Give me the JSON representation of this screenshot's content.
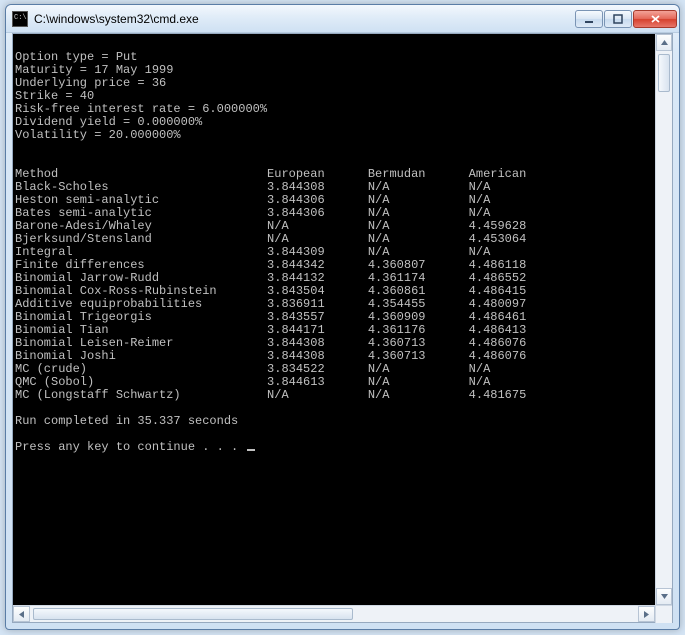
{
  "window": {
    "title": "C:\\windows\\system32\\cmd.exe"
  },
  "output": {
    "params": [
      "Option type = Put",
      "Maturity = 17 May 1999",
      "Underlying price = 36",
      "Strike = 40",
      "Risk-free interest rate = 6.000000%",
      "Dividend yield = 0.000000%",
      "Volatility = 20.000000%"
    ],
    "table": {
      "headers": [
        "Method",
        "European",
        "Bermudan",
        "American"
      ],
      "rows": [
        {
          "method": "Black-Scholes",
          "european": "3.844308",
          "bermudan": "N/A",
          "american": "N/A"
        },
        {
          "method": "Heston semi-analytic",
          "european": "3.844306",
          "bermudan": "N/A",
          "american": "N/A"
        },
        {
          "method": "Bates semi-analytic",
          "european": "3.844306",
          "bermudan": "N/A",
          "american": "N/A"
        },
        {
          "method": "Barone-Adesi/Whaley",
          "european": "N/A",
          "bermudan": "N/A",
          "american": "4.459628"
        },
        {
          "method": "Bjerksund/Stensland",
          "european": "N/A",
          "bermudan": "N/A",
          "american": "4.453064"
        },
        {
          "method": "Integral",
          "european": "3.844309",
          "bermudan": "N/A",
          "american": "N/A"
        },
        {
          "method": "Finite differences",
          "european": "3.844342",
          "bermudan": "4.360807",
          "american": "4.486118"
        },
        {
          "method": "Binomial Jarrow-Rudd",
          "european": "3.844132",
          "bermudan": "4.361174",
          "american": "4.486552"
        },
        {
          "method": "Binomial Cox-Ross-Rubinstein",
          "european": "3.843504",
          "bermudan": "4.360861",
          "american": "4.486415"
        },
        {
          "method": "Additive equiprobabilities",
          "european": "3.836911",
          "bermudan": "4.354455",
          "american": "4.480097"
        },
        {
          "method": "Binomial Trigeorgis",
          "european": "3.843557",
          "bermudan": "4.360909",
          "american": "4.486461"
        },
        {
          "method": "Binomial Tian",
          "european": "3.844171",
          "bermudan": "4.361176",
          "american": "4.486413"
        },
        {
          "method": "Binomial Leisen-Reimer",
          "european": "3.844308",
          "bermudan": "4.360713",
          "american": "4.486076"
        },
        {
          "method": "Binomial Joshi",
          "european": "3.844308",
          "bermudan": "4.360713",
          "american": "4.486076"
        },
        {
          "method": "MC (crude)",
          "european": "3.834522",
          "bermudan": "N/A",
          "american": "N/A"
        },
        {
          "method": "QMC (Sobol)",
          "european": "3.844613",
          "bermudan": "N/A",
          "american": "N/A"
        },
        {
          "method": "MC (Longstaff Schwartz)",
          "european": "N/A",
          "bermudan": "N/A",
          "american": "4.481675"
        }
      ]
    },
    "footer1": "Run completed in 35.337 seconds",
    "footer2": "Press any key to continue . . . "
  },
  "chart_data": {
    "type": "table",
    "title": "Option pricing methods comparison",
    "columns": [
      "Method",
      "European",
      "Bermudan",
      "American"
    ],
    "parameters": {
      "option_type": "Put",
      "maturity": "17 May 1999",
      "underlying_price": 36,
      "strike": 40,
      "risk_free_rate_pct": 6.0,
      "dividend_yield_pct": 0.0,
      "volatility_pct": 20.0
    },
    "rows": [
      [
        "Black-Scholes",
        3.844308,
        null,
        null
      ],
      [
        "Heston semi-analytic",
        3.844306,
        null,
        null
      ],
      [
        "Bates semi-analytic",
        3.844306,
        null,
        null
      ],
      [
        "Barone-Adesi/Whaley",
        null,
        null,
        4.459628
      ],
      [
        "Bjerksund/Stensland",
        null,
        null,
        4.453064
      ],
      [
        "Integral",
        3.844309,
        null,
        null
      ],
      [
        "Finite differences",
        3.844342,
        4.360807,
        4.486118
      ],
      [
        "Binomial Jarrow-Rudd",
        3.844132,
        4.361174,
        4.486552
      ],
      [
        "Binomial Cox-Ross-Rubinstein",
        3.843504,
        4.360861,
        4.486415
      ],
      [
        "Additive equiprobabilities",
        3.836911,
        4.354455,
        4.480097
      ],
      [
        "Binomial Trigeorgis",
        3.843557,
        4.360909,
        4.486461
      ],
      [
        "Binomial Tian",
        3.844171,
        4.361176,
        4.486413
      ],
      [
        "Binomial Leisen-Reimer",
        3.844308,
        4.360713,
        4.486076
      ],
      [
        "Binomial Joshi",
        3.844308,
        4.360713,
        4.486076
      ],
      [
        "MC (crude)",
        3.834522,
        null,
        null
      ],
      [
        "QMC (Sobol)",
        3.844613,
        null,
        null
      ],
      [
        "MC (Longstaff Schwartz)",
        null,
        null,
        4.481675
      ]
    ],
    "run_time_seconds": 35.337
  }
}
